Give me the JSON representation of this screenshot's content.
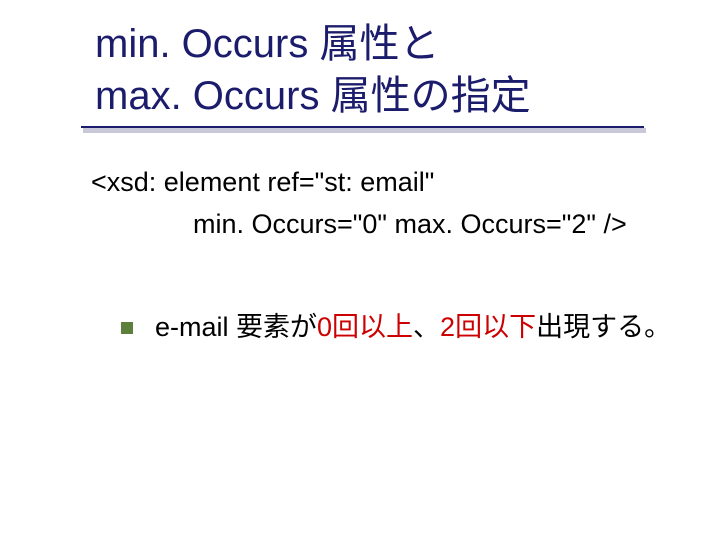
{
  "title_line1": "min. Occurs 属性と",
  "title_line2": "max. Occurs 属性の指定",
  "code_line1": "<xsd: element ref=\"st: email\"",
  "code_line2": "min. Occurs=\"0\" max. Occurs=\"2\" />",
  "bullet_pre": "e-mail 要素が",
  "bullet_red1": "0回以上",
  "bullet_mid": "、",
  "bullet_red2": "2回以下",
  "bullet_post": "出現する。"
}
